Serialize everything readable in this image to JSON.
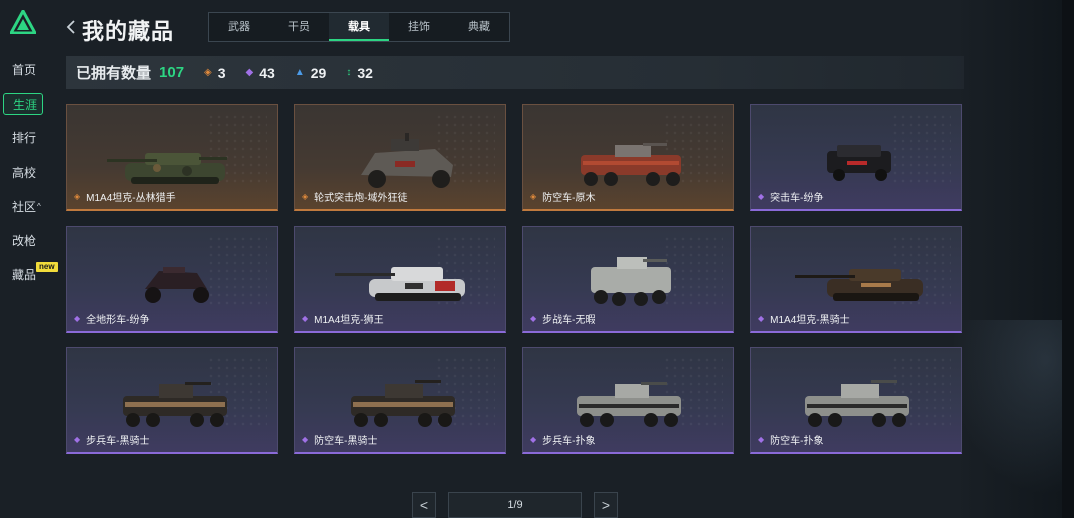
{
  "sidebar": {
    "items": [
      {
        "label": "首页",
        "active": false
      },
      {
        "label": "生涯",
        "active": true
      },
      {
        "label": "排行",
        "active": false
      },
      {
        "label": "高校",
        "active": false
      },
      {
        "label": "社区",
        "active": false,
        "caret": "^"
      },
      {
        "label": "改枪",
        "active": false
      },
      {
        "label": "藏品",
        "active": false
      }
    ],
    "new_badge": "new"
  },
  "header": {
    "title": "我的藏品",
    "tabs": [
      {
        "label": "武器",
        "active": false
      },
      {
        "label": "干员",
        "active": false
      },
      {
        "label": "载具",
        "active": true
      },
      {
        "label": "挂饰",
        "active": false
      },
      {
        "label": "典藏",
        "active": false
      }
    ]
  },
  "counts": {
    "label": "已拥有数量",
    "total": "107",
    "rarities": [
      {
        "icon": "orange-diamond-icon",
        "value": "3"
      },
      {
        "icon": "purple-diamond-icon",
        "value": "43"
      },
      {
        "icon": "blue-chevron-icon",
        "value": "29"
      },
      {
        "icon": "green-arrows-icon",
        "value": "32"
      }
    ]
  },
  "vehicles": [
    {
      "name": "M1A4坦克-丛林猎手",
      "rarity": "orange",
      "kind": "tank-camo"
    },
    {
      "name": "轮式突击炮-域外狂徒",
      "rarity": "orange",
      "kind": "buggy"
    },
    {
      "name": "防空车-原木",
      "rarity": "orange",
      "kind": "apc-red"
    },
    {
      "name": "突击车-纷争",
      "rarity": "purple",
      "kind": "suv"
    },
    {
      "name": "全地形车-纷争",
      "rarity": "purple",
      "kind": "atv"
    },
    {
      "name": "M1A4坦克-狮王",
      "rarity": "purple",
      "kind": "tank-white"
    },
    {
      "name": "步战车-无暇",
      "rarity": "purple",
      "kind": "ifv-white"
    },
    {
      "name": "M1A4坦克-黑骑士",
      "rarity": "purple",
      "kind": "tank-black"
    },
    {
      "name": "步兵车-黑骑士",
      "rarity": "purple",
      "kind": "apc-black"
    },
    {
      "name": "防空车-黑骑士",
      "rarity": "purple",
      "kind": "apc-black2"
    },
    {
      "name": "步兵车-扑象",
      "rarity": "purple",
      "kind": "apc-white"
    },
    {
      "name": "防空车-扑象",
      "rarity": "purple",
      "kind": "apc-white2"
    }
  ],
  "pagination": {
    "prev": "<",
    "page_text": "1/9",
    "next": ">"
  },
  "colors": {
    "accent": "#2dd583",
    "orange": "#e08a3c",
    "purple": "#a071e6",
    "blue": "#4c9be8"
  }
}
